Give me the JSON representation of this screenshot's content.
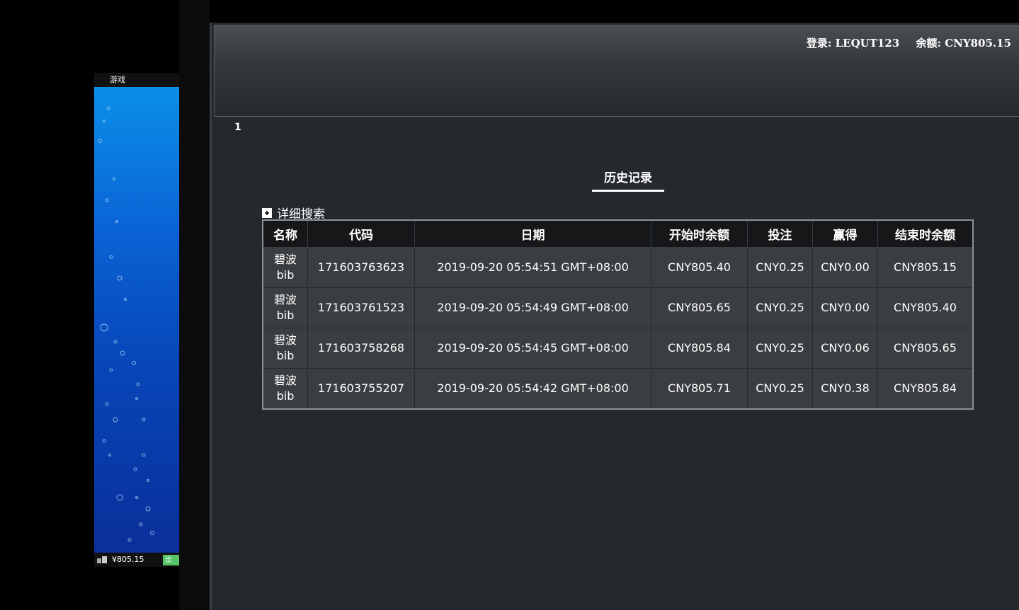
{
  "game": {
    "header_label": "游戏",
    "footer_balance": "¥805.15",
    "exit_label": "出"
  },
  "header": {
    "login_label": "登录: LEQUT123",
    "balance_label": "余额: CNY805.15"
  },
  "page_number": "1",
  "history": {
    "title": "历史记录",
    "detail_search_label": "详细搜索",
    "columns": [
      "名称",
      "代码",
      "日期",
      "开始时余额",
      "投注",
      "赢得",
      "结束时余额"
    ],
    "rows": [
      {
        "name": "碧波",
        "name_en": "bib",
        "code": "171603763623",
        "date": "2019-09-20 05:54:51 GMT+08:00",
        "start_balance": "CNY805.40",
        "bet": "CNY0.25",
        "win": "CNY0.00",
        "end_balance": "CNY805.15"
      },
      {
        "name": "碧波",
        "name_en": "bib",
        "code": "171603761523",
        "date": "2019-09-20 05:54:49 GMT+08:00",
        "start_balance": "CNY805.65",
        "bet": "CNY0.25",
        "win": "CNY0.00",
        "end_balance": "CNY805.40"
      },
      {
        "name": "碧波",
        "name_en": "bib",
        "code": "171603758268",
        "date": "2019-09-20 05:54:45 GMT+08:00",
        "start_balance": "CNY805.84",
        "bet": "CNY0.25",
        "win": "CNY0.06",
        "end_balance": "CNY805.65"
      },
      {
        "name": "碧波",
        "name_en": "bib",
        "code": "171603755207",
        "date": "2019-09-20 05:54:42 GMT+08:00",
        "start_balance": "CNY805.71",
        "bet": "CNY0.25",
        "win": "CNY0.38",
        "end_balance": "CNY805.84"
      }
    ]
  },
  "colors": {
    "panel_bg": "#25292d",
    "table_header_bg": "#151719",
    "table_row_bg": "#3b3e41",
    "exit_button": "#57c46a",
    "game_water": "#0a64d6"
  }
}
